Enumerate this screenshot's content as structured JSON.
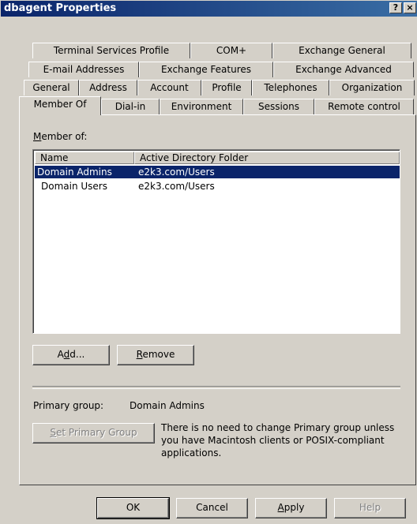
{
  "window": {
    "title": "dbagent Properties",
    "help_glyph": "?",
    "close_glyph": "×"
  },
  "tabs": {
    "row1": [
      "Terminal Services Profile",
      "COM+",
      "Exchange General"
    ],
    "row2": [
      "E-mail Addresses",
      "Exchange Features",
      "Exchange Advanced"
    ],
    "row3": [
      "General",
      "Address",
      "Account",
      "Profile",
      "Telephones",
      "Organization"
    ],
    "row4": [
      "Member Of",
      "Dial-in",
      "Environment",
      "Sessions",
      "Remote control"
    ],
    "active": "Member Of"
  },
  "member_of": {
    "label_first": "M",
    "label_rest": "ember of:",
    "columns": [
      "Name",
      "Active Directory Folder"
    ],
    "rows": [
      {
        "name": "Domain Admins",
        "folder": "e2k3.com/Users",
        "selected": true
      },
      {
        "name": "Domain Users",
        "folder": "e2k3.com/Users",
        "selected": false
      }
    ]
  },
  "buttons": {
    "add_pre": "A",
    "add_u": "d",
    "add_post": "d...",
    "remove_u": "R",
    "remove_post": "emove",
    "set_primary_u": "S",
    "set_primary_post": "et Primary Group",
    "ok": "OK",
    "cancel": "Cancel",
    "apply_u": "A",
    "apply_post": "pply",
    "help": "Help"
  },
  "primary_group": {
    "label": "Primary group:",
    "value": "Domain Admins",
    "note_line1": "There is no need to change Primary group unless",
    "note_line2": "you have Macintosh clients or POSIX-compliant",
    "note_line3": "applications."
  }
}
